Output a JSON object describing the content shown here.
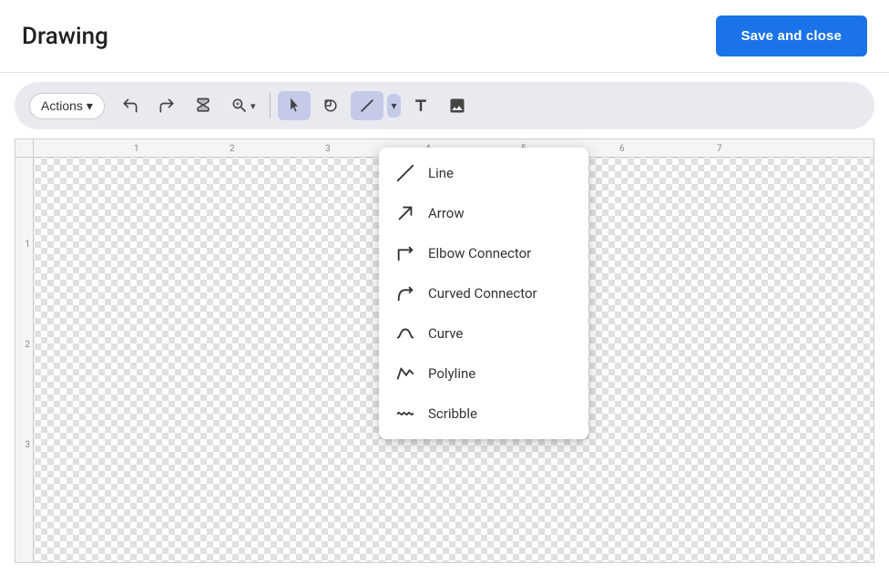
{
  "header": {
    "title": "Drawing",
    "save_button_label": "Save and close"
  },
  "toolbar": {
    "actions_label": "Actions",
    "actions_chevron": "▾",
    "tools": [
      {
        "name": "undo",
        "icon": "undo"
      },
      {
        "name": "redo",
        "icon": "redo"
      },
      {
        "name": "paint-format",
        "icon": "paint"
      },
      {
        "name": "zoom",
        "icon": "zoom"
      },
      {
        "name": "select",
        "icon": "cursor",
        "active": true
      },
      {
        "name": "shape",
        "icon": "shape"
      },
      {
        "name": "line",
        "icon": "line",
        "has_dropdown": true
      },
      {
        "name": "text",
        "icon": "text"
      },
      {
        "name": "image",
        "icon": "image"
      }
    ]
  },
  "line_menu": {
    "items": [
      {
        "id": "line",
        "label": "Line"
      },
      {
        "id": "arrow",
        "label": "Arrow"
      },
      {
        "id": "elbow-connector",
        "label": "Elbow Connector"
      },
      {
        "id": "curved-connector",
        "label": "Curved Connector"
      },
      {
        "id": "curve",
        "label": "Curve"
      },
      {
        "id": "polyline",
        "label": "Polyline"
      },
      {
        "id": "scribble",
        "label": "Scribble"
      }
    ]
  },
  "ruler": {
    "top_numbers": [
      "1",
      "2",
      "3",
      "4",
      "5",
      "6",
      "7"
    ],
    "left_numbers": [
      "1",
      "2",
      "3"
    ]
  }
}
